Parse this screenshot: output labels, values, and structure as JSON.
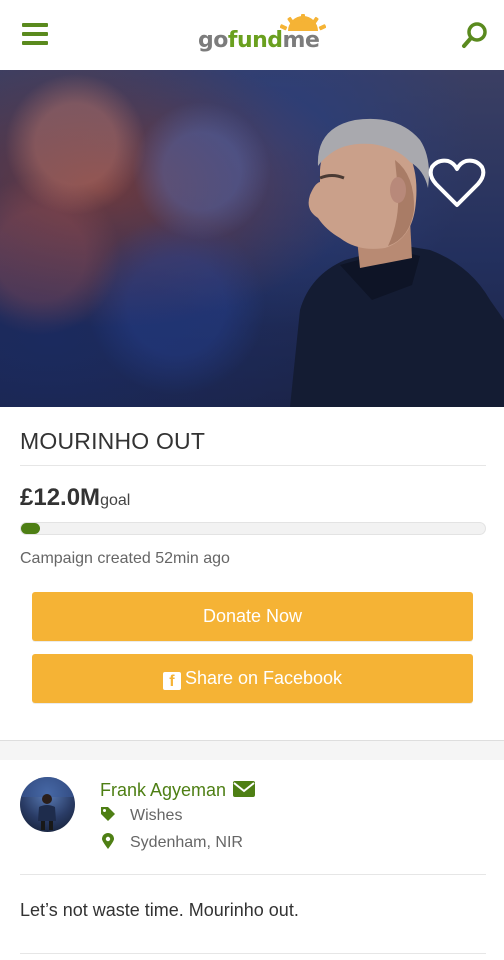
{
  "header": {
    "logo": {
      "go": "go",
      "fund": "fund",
      "me": "me"
    }
  },
  "campaign": {
    "title": "MOURINHO OUT",
    "amount": "£12.0M",
    "goal_label": "goal",
    "progress_fraction": 0.04,
    "created": "Campaign created 52min ago"
  },
  "actions": {
    "donate_label": "Donate Now",
    "share_label": "Share on Facebook"
  },
  "organizer": {
    "name": "Frank Agyeman",
    "category": "Wishes",
    "location": "Sydenham, NIR"
  },
  "story": {
    "text": "Let’s not waste time. Mourinho out."
  },
  "colors": {
    "brand_green": "#4e7f14",
    "button_orange": "#f5b335"
  },
  "icons": [
    "menu-icon",
    "search-icon",
    "heart-icon",
    "facebook-icon",
    "envelope-icon",
    "tag-icon",
    "map-marker-icon"
  ]
}
